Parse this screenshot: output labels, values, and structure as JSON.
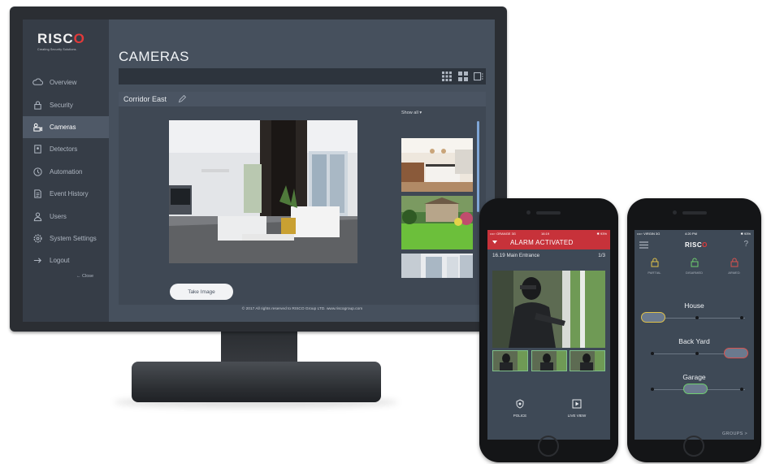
{
  "desktop": {
    "logo": {
      "brand_prefix": "RISC",
      "brand_suffix": "O",
      "tagline": "Creating Security Solutions."
    },
    "sidebar": {
      "items": [
        {
          "label": "Overview",
          "icon": "cloud-icon"
        },
        {
          "label": "Security",
          "icon": "lock-icon"
        },
        {
          "label": "Cameras",
          "icon": "camera-icon",
          "active": true
        },
        {
          "label": "Detectors",
          "icon": "detector-icon"
        },
        {
          "label": "Automation",
          "icon": "automation-icon"
        },
        {
          "label": "Event History",
          "icon": "history-icon"
        },
        {
          "label": "Users",
          "icon": "user-icon"
        },
        {
          "label": "System Settings",
          "icon": "gear-icon"
        },
        {
          "label": "Logout",
          "icon": "logout-icon"
        }
      ],
      "close_label": "← Close"
    },
    "page_title": "CAMERAS",
    "toolbar": {
      "views": [
        "grid-9-icon",
        "grid-4-icon",
        "single-view-icon"
      ]
    },
    "panel": {
      "camera_name": "Corridor East",
      "show_all_label": "Show all ▾",
      "take_image_label": "Take Image"
    },
    "footer": "© 2017 All rights reserved to RISCO Group LTD. www.riscogroup.com"
  },
  "phone_alarm": {
    "status": {
      "carrier": "••••◦ ORANGE  3G",
      "time": "16:19",
      "battery": "✱ 93%"
    },
    "alarm_title": "ALARM ACTIVATED",
    "event_line": "16.19 Main Entrance",
    "event_count": "1/3",
    "buttons": [
      {
        "label": "POLICE",
        "icon": "police-icon"
      },
      {
        "label": "LIVE VIEW",
        "icon": "play-icon"
      }
    ]
  },
  "phone_security": {
    "status": {
      "carrier": "••••◦ VIRGIN  3G",
      "time": "4:20 PM",
      "battery": "✱ 93%"
    },
    "logo": {
      "brand_prefix": "RISC",
      "brand_suffix": "O"
    },
    "help": "?",
    "modes": [
      {
        "label": "PARTIAL",
        "color": "#e0c24a"
      },
      {
        "label": "DISARMED",
        "color": "#6fcf6f"
      },
      {
        "label": "ARMED",
        "color": "#d9534f"
      }
    ],
    "zones": [
      {
        "name": "House",
        "state": "partial"
      },
      {
        "name": "Back Yard",
        "state": "armed"
      },
      {
        "name": "Garage",
        "state": "disarmed"
      }
    ],
    "groups_label": "GROUPS >"
  },
  "colors": {
    "accent_red": "#c7323a",
    "sidebar": "#363d47",
    "content": "#46505d"
  }
}
